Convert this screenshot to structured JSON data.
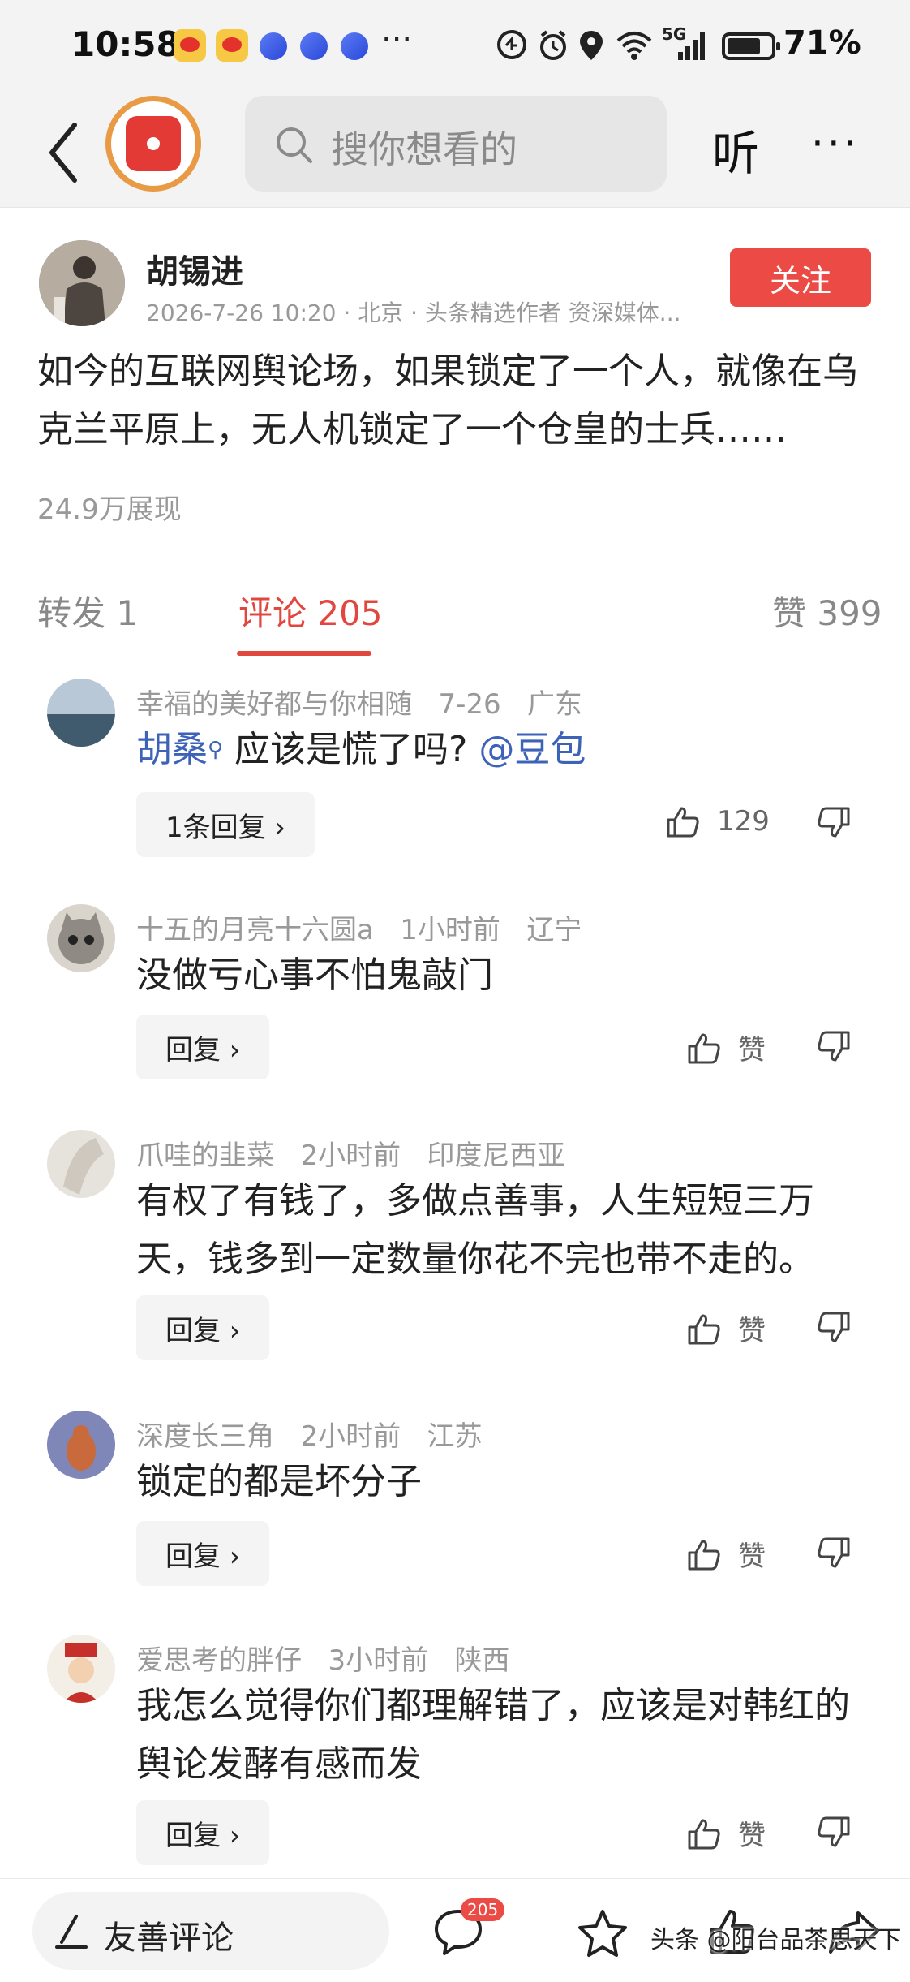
{
  "status_bar": {
    "time": "10:58",
    "more": "···",
    "battery": "71%",
    "network": "5G"
  },
  "header": {
    "search_placeholder": "搜你想看的",
    "listen_label": "听",
    "more_label": "···"
  },
  "post": {
    "author": "胡锡进",
    "meta": "2026-7-26 10:20 · 北京 · 头条精选作者 资深媒体...",
    "follow_label": "关注",
    "body": "如今的互联网舆论场，如果锁定了一个人，就像在乌克兰平原上，无人机锁定了一个仓皇的士兵……",
    "views": "24.9万展现"
  },
  "tabs": {
    "repost": "转发 1",
    "comments": "评论 205",
    "likes": "赞 399"
  },
  "comments": [
    {
      "user": "幸福的美好都与你相随",
      "time": "7-26",
      "region": "广东",
      "mention1": "胡桑",
      "text": " 应该是慌了吗? ",
      "mention2": "@豆包",
      "reply_label": "1条回复 ›",
      "like_label": "129"
    },
    {
      "user": "十五的月亮十六圆a",
      "time": "1小时前",
      "region": "辽宁",
      "text": "没做亏心事不怕鬼敲门",
      "reply_label": "回复 ›",
      "like_label": "赞"
    },
    {
      "user": "爪哇的韭菜",
      "time": "2小时前",
      "region": "印度尼西亚",
      "text": "有权了有钱了，多做点善事，人生短短三万天，钱多到一定数量你花不完也带不走的。",
      "reply_label": "回复 ›",
      "like_label": "赞"
    },
    {
      "user": "深度长三角",
      "time": "2小时前",
      "region": "江苏",
      "text": "锁定的都是坏分子",
      "reply_label": "回复 ›",
      "like_label": "赞"
    },
    {
      "user": "爱思考的胖仔",
      "time": "3小时前",
      "region": "陕西",
      "text": "我怎么觉得你们都理解错了，应该是对韩红的舆论发酵有感而发",
      "reply_label": "回复 ›",
      "like_label": "赞"
    }
  ],
  "bottom_bar": {
    "comment_placeholder": "友善评论",
    "comment_count_badge": "205",
    "watermark": "头条 @阳台品茶思天下"
  },
  "colors": {
    "accent_red": "#eb4a45",
    "link_blue": "#3d63b8"
  }
}
